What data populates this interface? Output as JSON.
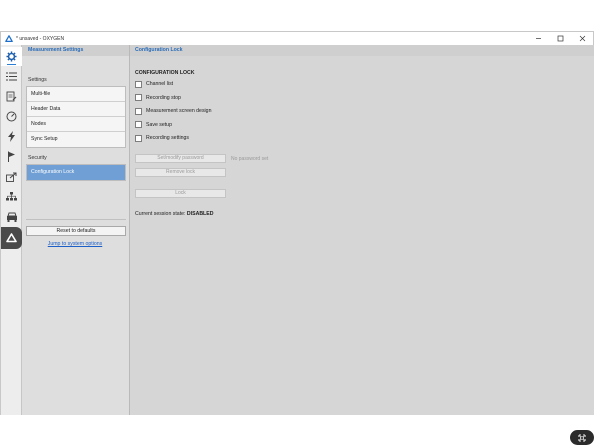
{
  "window": {
    "title": "* unsaved - OXYGEN"
  },
  "rail": {
    "items": [
      {
        "icon": "gear-icon",
        "active": true
      },
      {
        "icon": "list-icon"
      },
      {
        "icon": "edit-document-icon"
      },
      {
        "icon": "gauge-icon"
      },
      {
        "icon": "lightning-icon"
      },
      {
        "icon": "flag-icon"
      },
      {
        "icon": "export-icon"
      },
      {
        "icon": "network-icon"
      },
      {
        "icon": "vehicle-icon"
      },
      {
        "icon": "oxygen-logo-icon",
        "dark": true
      }
    ]
  },
  "left_panel": {
    "header": "Measurement Settings",
    "settings_label": "Settings",
    "settings_items": [
      "Multi-file",
      "Header Data",
      "Nodes",
      "Sync Setup"
    ],
    "security_label": "Security",
    "security_items": [
      "Configuration Lock"
    ],
    "reset_button": "Reset to defaults",
    "system_link": "Jump to system options"
  },
  "main": {
    "header": "Configuration Lock",
    "section_title": "CONFIGURATION LOCK",
    "checkboxes": [
      {
        "label": "Channel list",
        "checked": false
      },
      {
        "label": "Recording stop",
        "checked": false
      },
      {
        "label": "Measurement screen design",
        "checked": false
      },
      {
        "label": "Save setup",
        "checked": false
      },
      {
        "label": "Recording settings",
        "checked": false
      }
    ],
    "set_password_button": "Set/modify password",
    "password_hint": "No password set",
    "remove_lock_button": "Remove lock",
    "lock_button": "Lock",
    "state_label": "Current session state:",
    "state_value": "DISABLED"
  },
  "colors": {
    "accent": "#2a6cb8",
    "selected": "#6f9fd4",
    "link": "#1c5fc7"
  }
}
